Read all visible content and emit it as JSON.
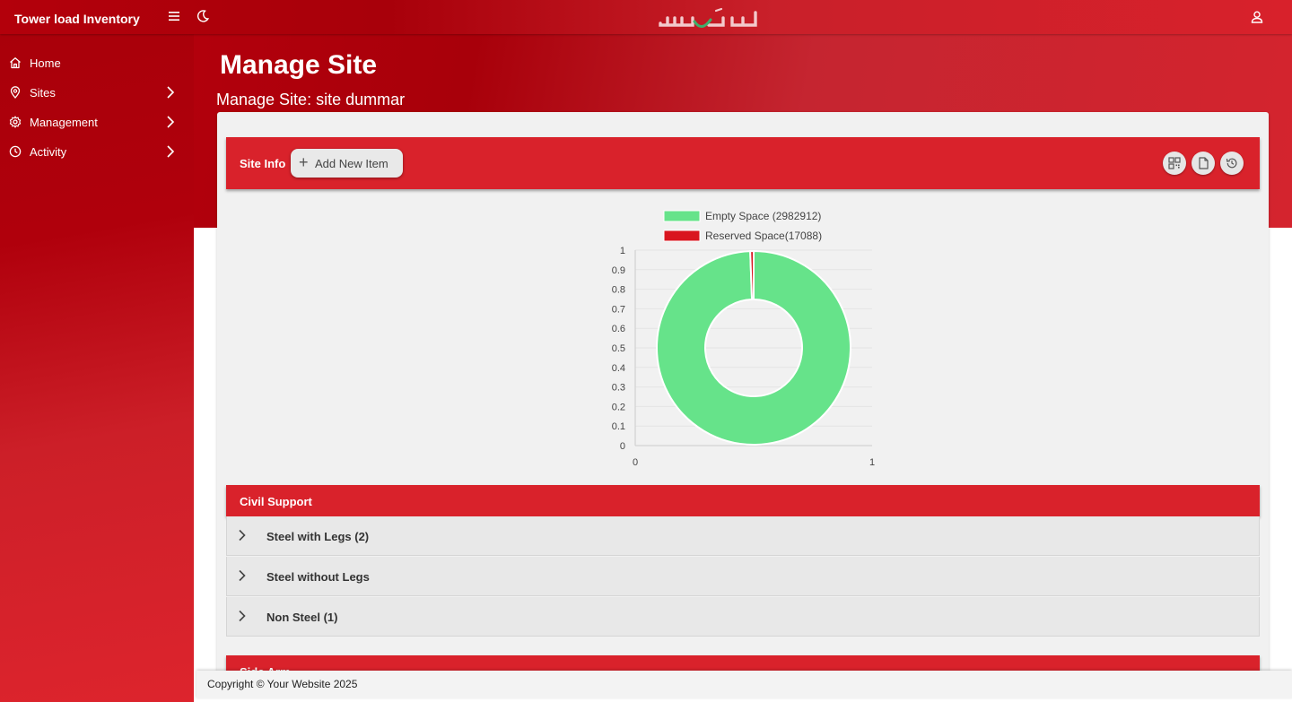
{
  "app": {
    "title": "Tower load Inventory",
    "logo_text": "سيريتل"
  },
  "sidebar": {
    "items": [
      {
        "label": "Home",
        "icon": "home-icon"
      },
      {
        "label": "Sites",
        "icon": "map-pin-icon"
      },
      {
        "label": "Management",
        "icon": "gear-icon"
      },
      {
        "label": "Activity",
        "icon": "clock-icon"
      }
    ]
  },
  "page": {
    "title": "Manage Site",
    "subtitle": "Manage Site: site dummar"
  },
  "site_info": {
    "title": "Site Info",
    "add_button": "Add New Item",
    "actions": [
      "qr-code-icon",
      "document-icon",
      "history-icon"
    ]
  },
  "chart_data": {
    "type": "pie",
    "series": [
      {
        "name": "Empty Space (2982912)",
        "value": 2982912,
        "color": "#66e38a"
      },
      {
        "name": "Reserved Space(17088)",
        "value": 17088,
        "color": "#d9151f"
      }
    ],
    "y_ticks": [
      "1",
      "0.9",
      "0.8",
      "0.7",
      "0.6",
      "0.5",
      "0.4",
      "0.3",
      "0.2",
      "0.1",
      "0"
    ],
    "x_ticks": [
      "0",
      "1"
    ],
    "legend": "top",
    "grid": true
  },
  "civil_support": {
    "title": "Civil Support",
    "items": [
      "Steel with Legs (2)",
      "Steel without Legs",
      "Non Steel (1)"
    ]
  },
  "side_arm": {
    "title": "Side Arm"
  },
  "footer": {
    "text": "Copyright © Your Website 2025"
  },
  "colors": {
    "brand_red": "#d9222b",
    "dark_red": "#a8000a",
    "green": "#66e38a"
  }
}
